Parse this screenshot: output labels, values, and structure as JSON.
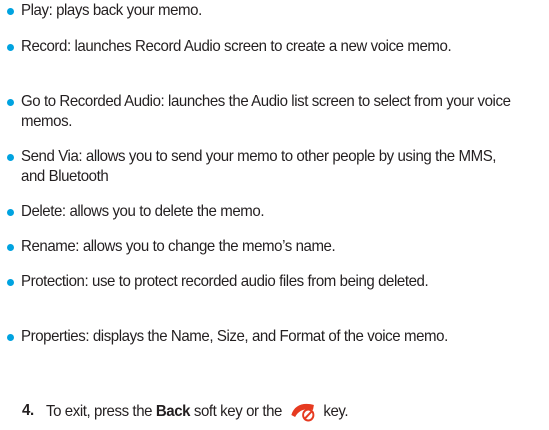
{
  "bullets": [
    {
      "text": "Play: plays back your memo."
    },
    {
      "text": "Record: launches Record Audio screen to create a new voice memo."
    },
    {
      "text": "Go to Recorded Audio: launches the Audio list screen to select from your voice memos."
    },
    {
      "text": "Send Via: allows you to send your memo to other people by using the MMS, and Bluetooth"
    },
    {
      "text": "Delete: allows you to delete the memo."
    },
    {
      "text": "Rename: allows you to change the memo’s name."
    },
    {
      "text": "Protection: use to protect recorded audio files from being deleted."
    },
    {
      "text": "Properties: displays the Name, Size, and Format of the voice memo."
    }
  ],
  "step": {
    "number": "4.",
    "text_before": "To exit, press the",
    "bold_word": "Back",
    "text_middle": "soft key or the",
    "text_after": "key.",
    "icon": "end-call-key-icon"
  },
  "colors": {
    "bullet": "#00a3e0",
    "text": "#231f20",
    "icon_bg": "#e63a20"
  }
}
